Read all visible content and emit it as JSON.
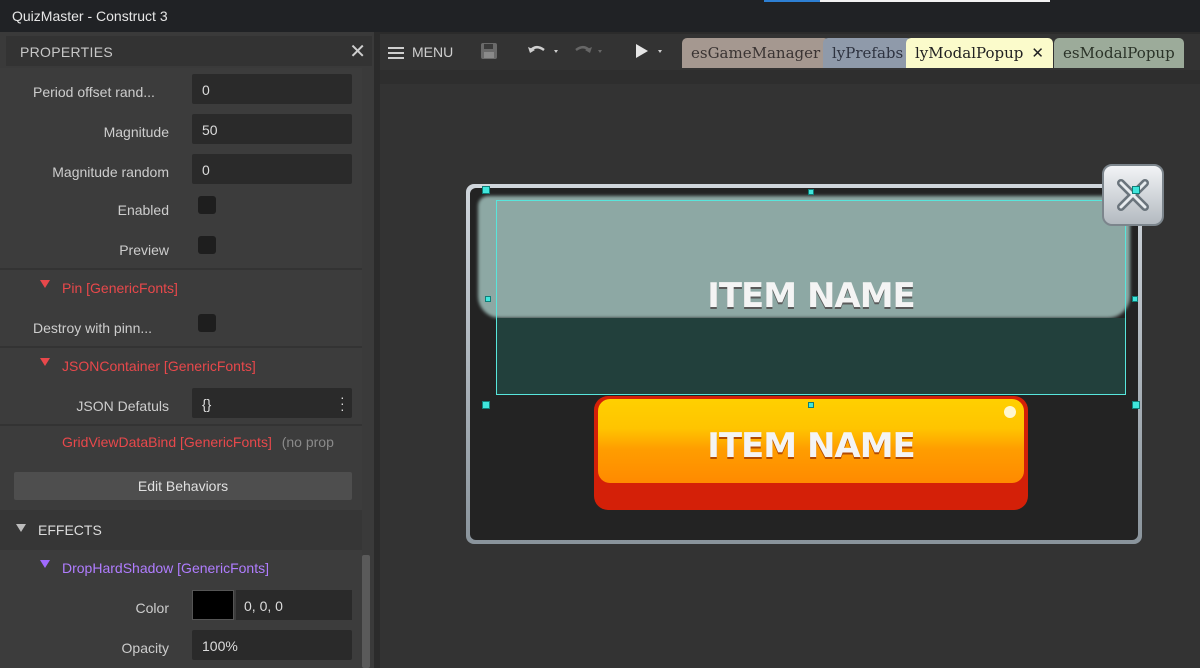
{
  "window": {
    "title": "QuizMaster - Construct 3"
  },
  "properties": {
    "title": "PROPERTIES",
    "close_glyph": "✕",
    "rows": {
      "period_offset_random": {
        "label": "Period offset rand...",
        "value": "0"
      },
      "magnitude": {
        "label": "Magnitude",
        "value": "50"
      },
      "magnitude_random": {
        "label": "Magnitude random",
        "value": "0"
      },
      "enabled": {
        "label": "Enabled",
        "checked": false
      },
      "preview": {
        "label": "Preview",
        "checked": false
      },
      "destroy_with_pinned": {
        "label": "Destroy with pinn...",
        "checked": false
      },
      "json_defaults": {
        "label": "JSON Defatuls",
        "value": "{}"
      },
      "color": {
        "label": "Color",
        "value": "0, 0, 0",
        "swatch": "#000000"
      },
      "opacity": {
        "label": "Opacity",
        "value": "100%"
      }
    },
    "sections": {
      "pin": "Pin [GenericFonts]",
      "json_container": "JSONContainer [GenericFonts]",
      "grid_view": "GridViewDataBind [GenericFonts]",
      "grid_view_note": "(no prop",
      "drop_shadow": "DropHardShadow [GenericFonts]"
    },
    "edit_behaviors": "Edit Behaviors",
    "effects": "EFFECTS"
  },
  "toolbar": {
    "menu_label": "MENU",
    "tabs": [
      {
        "label": "esGameManager",
        "bg": "#a59890",
        "color": "#3a3433"
      },
      {
        "label": "lyPrefabs",
        "bg": "#8f9aaa",
        "color": "#2e3340"
      },
      {
        "label": "lyModalPopup",
        "bg": "#fbfbcb",
        "color": "#222222",
        "active": true
      },
      {
        "label": "esModalPopup",
        "bg": "#9cab9a",
        "color": "#2b3328"
      }
    ],
    "tab_close_glyph": "✕"
  },
  "canvas": {
    "upper_label": "ITEM NAME",
    "button_label": "ITEM NAME"
  },
  "colors": {
    "accent_red": "#e8484b",
    "accent_purple": "#b07dff",
    "selection": "#40e6dc"
  }
}
